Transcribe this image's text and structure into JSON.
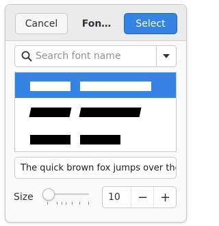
{
  "header": {
    "cancel_label": "Cancel",
    "title": "Fon…",
    "select_label": "Select"
  },
  "search": {
    "placeholder": "Search font name",
    "value": ""
  },
  "font_list": {
    "items": [
      {
        "selected": true
      },
      {
        "selected": false
      },
      {
        "selected": false
      }
    ]
  },
  "preview": {
    "text": "The quick brown fox jumps over the lazy dog."
  },
  "size": {
    "label": "Size",
    "value": "10",
    "slider_fraction": 0.0,
    "decrement_label": "−",
    "increment_label": "+"
  },
  "colors": {
    "accent": "#3584e4",
    "header_bg": "#ebebeb",
    "dialog_bg": "#fafafa"
  }
}
